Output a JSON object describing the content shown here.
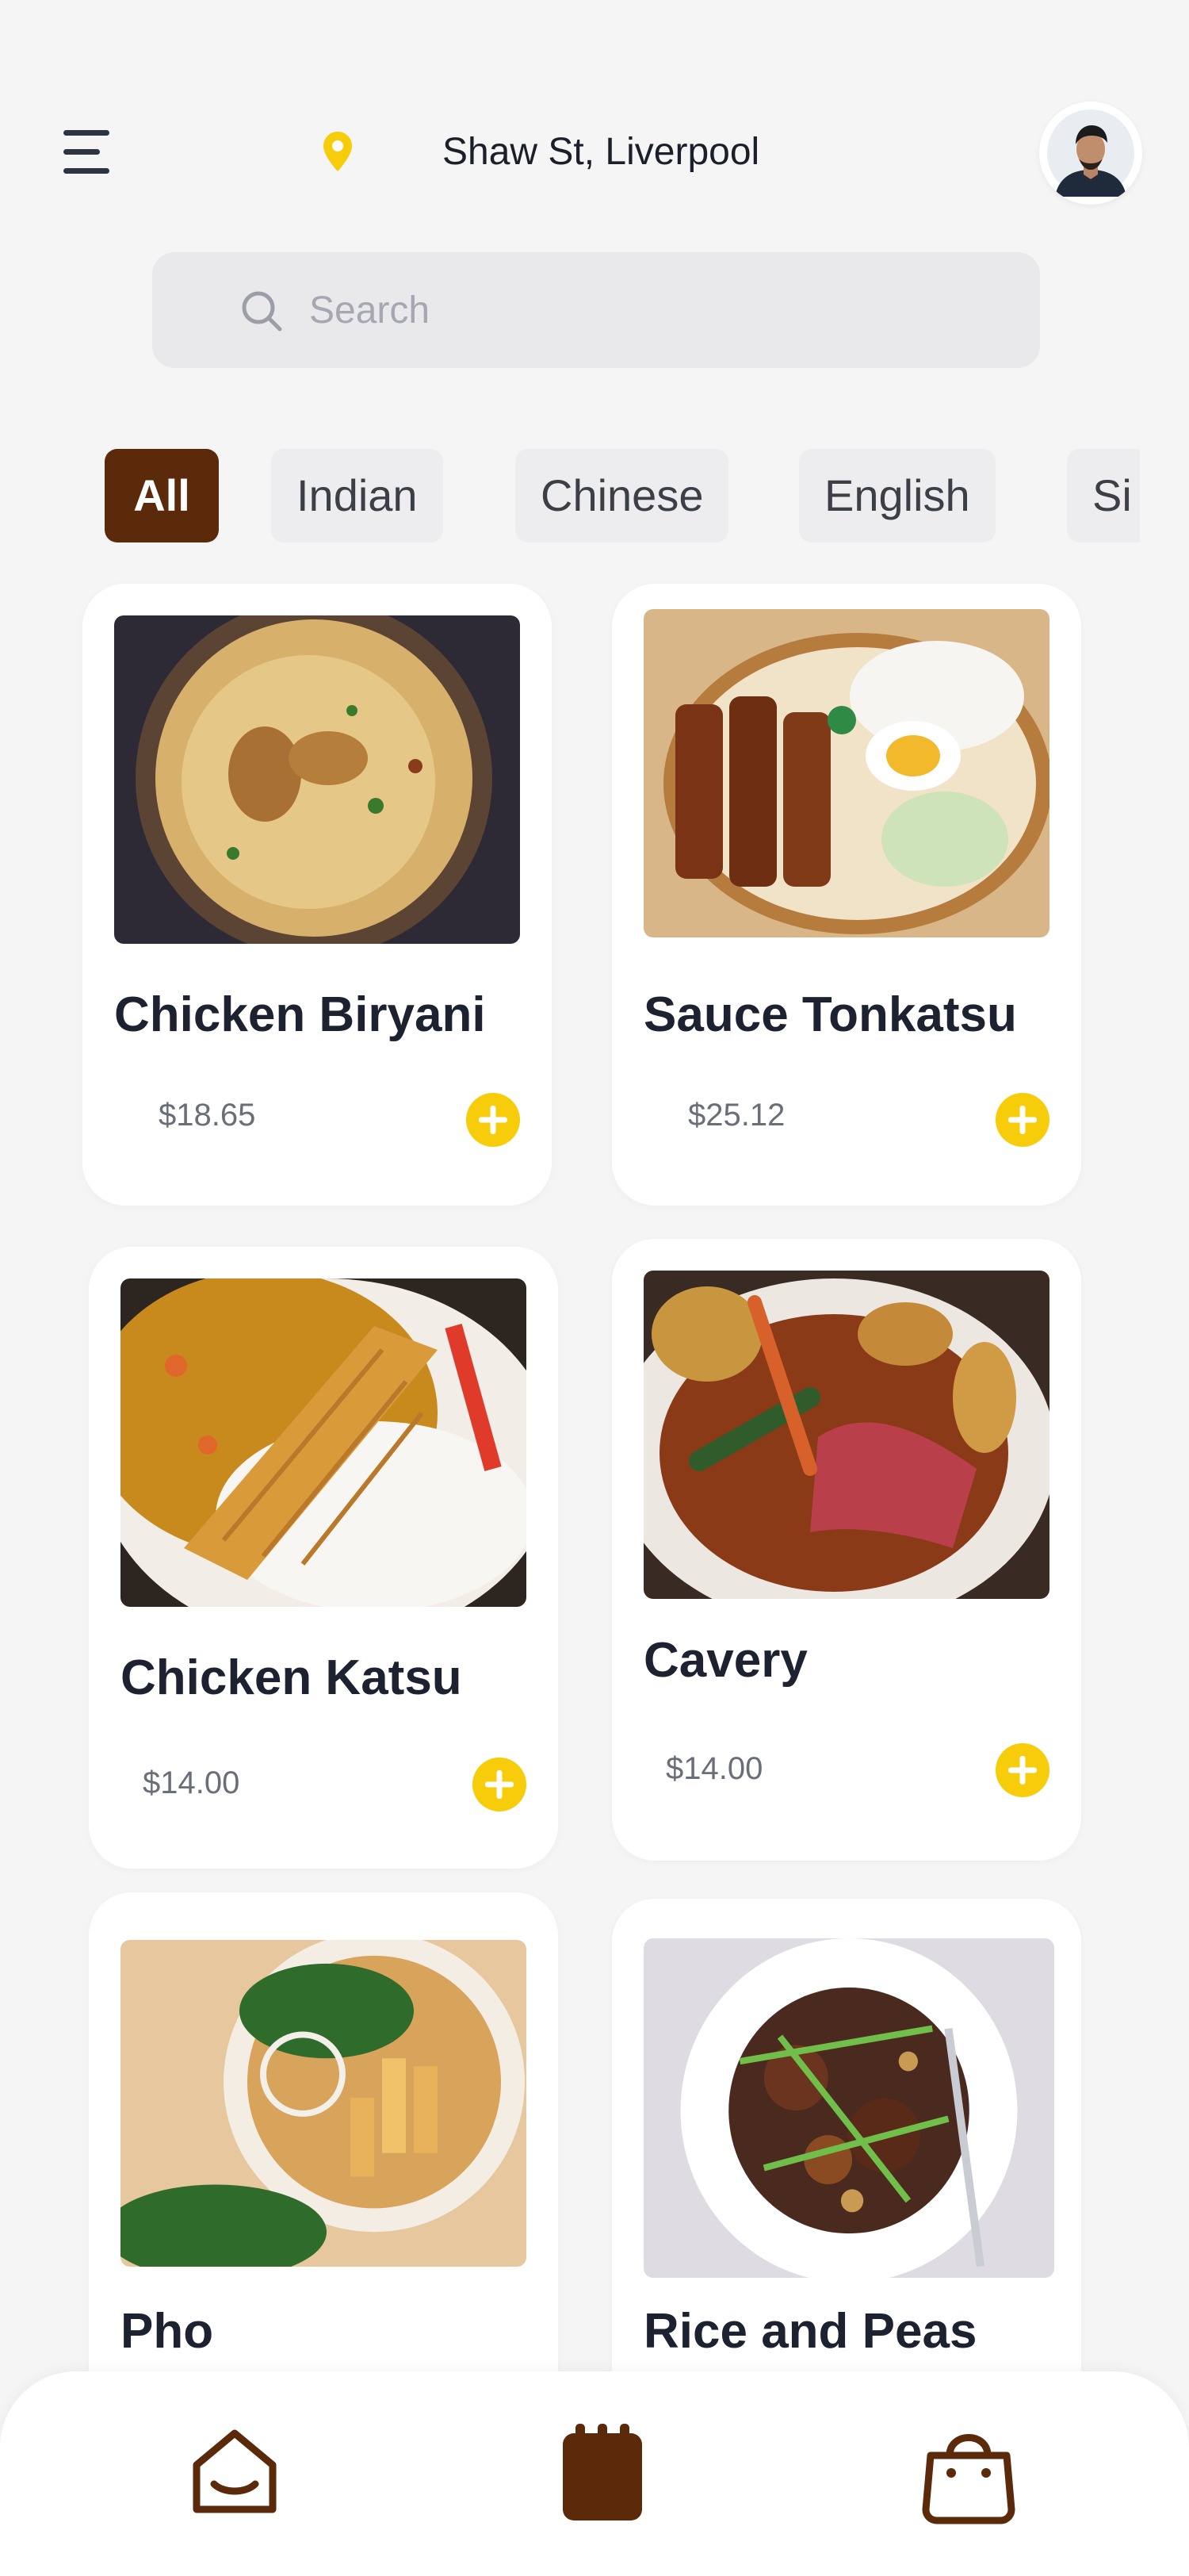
{
  "header": {
    "location": "Shaw St, Liverpool"
  },
  "search": {
    "placeholder": "Search"
  },
  "categories": [
    "All",
    "Indian",
    "Chinese",
    "English",
    "Si"
  ],
  "products": [
    {
      "name": "Chicken Biryani",
      "price": "$18.65"
    },
    {
      "name": "Sauce Tonkatsu",
      "price": "$25.12"
    },
    {
      "name": "Chicken Katsu",
      "price": "$14.00"
    },
    {
      "name": "Cavery",
      "price": "$14.00"
    },
    {
      "name": "Pho",
      "price": ""
    },
    {
      "name": "Rice and Peas",
      "price": ""
    }
  ],
  "icons": {
    "menu": "menu-icon",
    "location": "location-pin-icon",
    "search": "search-icon",
    "add": "plus-icon",
    "nav": [
      "home-icon",
      "calendar-icon",
      "shopping-bag-icon"
    ]
  },
  "colors": {
    "background": "#f5f5f6",
    "accent": "#f6cc0b",
    "brand_brown": "#5a2a0b",
    "text_dark": "#1d2230",
    "text_muted": "#6a6e78",
    "search_bg": "#e9e9ec"
  }
}
